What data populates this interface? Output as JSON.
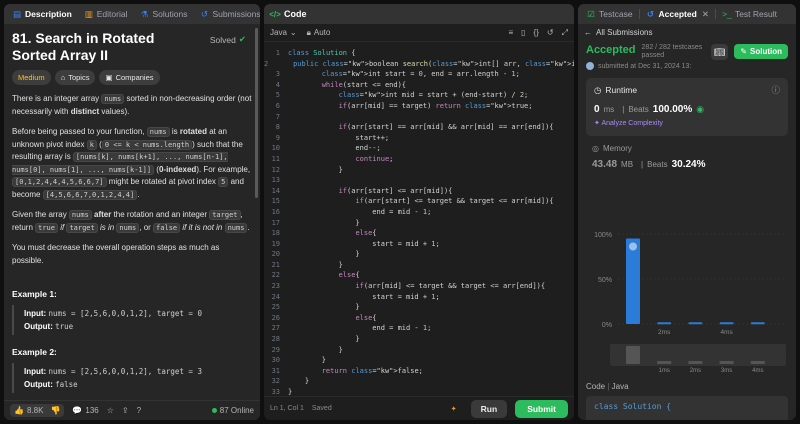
{
  "left": {
    "tabs": [
      {
        "label": "Description",
        "icon": "description-icon"
      },
      {
        "label": "Editorial",
        "icon": "editorial-icon"
      },
      {
        "label": "Solutions",
        "icon": "solutions-icon"
      },
      {
        "label": "Submissions",
        "icon": "submissions-icon"
      }
    ],
    "title": "81. Search in Rotated Sorted Array II",
    "solved": "Solved",
    "chips": {
      "difficulty": "Medium",
      "topics": "Topics",
      "companies": "Companies"
    },
    "p1": [
      "There is an integer array ",
      "nums",
      " sorted in non-decreasing order (not necessarily with ",
      "distinct",
      " values)."
    ],
    "p2": [
      "Before being passed to your function, ",
      "nums",
      " is ",
      "rotated",
      " at an unknown pivot index ",
      "k",
      " (",
      "0 <= k < nums.length",
      ") such that the resulting array is ",
      "[nums[k], nums[k+1], ..., nums[n-1], nums[0], nums[1], ..., nums[k-1]]",
      " (",
      "0-indexed",
      "). For example, ",
      "[0,1,2,4,4,4,5,6,6,7]",
      " might be rotated at pivot index ",
      "5",
      " and become ",
      "[4,5,6,6,7,0,1,2,4,4]",
      "."
    ],
    "p3": [
      "Given the array ",
      "nums",
      " ",
      "after",
      " the rotation and an integer ",
      "target",
      ", return ",
      "true",
      " if ",
      "target",
      " is in ",
      "nums",
      ", or ",
      "false",
      " if it is not in ",
      "nums",
      "."
    ],
    "p4": "You must decrease the overall operation steps as much as possible.",
    "examples": [
      {
        "heading": "Example 1:",
        "input_label": "Input:",
        "input": "nums = [2,5,6,0,0,1,2], target = 0",
        "output_label": "Output:",
        "output": "true"
      },
      {
        "heading": "Example 2:",
        "input_label": "Input:",
        "input": "nums = [2,5,6,0,0,1,2], target = 3",
        "output_label": "Output:",
        "output": "false"
      }
    ],
    "footer": {
      "likes": "8.8K",
      "comments": "136",
      "online": "87 Online"
    }
  },
  "mid": {
    "header": "Code",
    "language": "Java",
    "auto": "Auto",
    "code_lines": [
      "class Solution {",
      "    public boolean search(int[] arr, int target) {",
      "        int start = 0, end = arr.length - 1;",
      "        while(start <= end){",
      "            int mid = start + (end-start) / 2;",
      "            if(arr[mid] == target) return true;",
      "",
      "            if(arr[start] == arr[mid] && arr[mid] == arr[end]){",
      "                start++;",
      "                end--;",
      "                continue;",
      "            }",
      "",
      "            if(arr[start] <= arr[mid]){",
      "                if(arr[start] <= target && target <= arr[mid]){",
      "                    end = mid - 1;",
      "                }",
      "                else{",
      "                    start = mid + 1;",
      "                }",
      "            }",
      "            else{",
      "                if(arr[mid] <= target && target <= arr[end]){",
      "                    start = mid + 1;",
      "                }",
      "                else{",
      "                    end = mid - 1;",
      "                }",
      "            }",
      "        }",
      "        return false;",
      "    }",
      "}"
    ],
    "status": {
      "position": "Ln 1, Col 1",
      "saved": "Saved"
    },
    "run": "Run",
    "submit": "Submit"
  },
  "right": {
    "tabs": [
      {
        "label": "Testcase",
        "icon": "testcase-icon"
      },
      {
        "label": "Accepted",
        "icon": "accepted-icon"
      },
      {
        "label": "Test Result",
        "icon": "terminal-icon"
      }
    ],
    "all_submissions": "All Submissions",
    "accepted": "Accepted",
    "testcases": "282 / 282 testcases passed",
    "submitted": "submitted at Dec 31, 2024 13:",
    "solution_btn": "Solution",
    "runtime": {
      "label": "Runtime",
      "value": "0",
      "unit": "ms",
      "beats_label": "Beats",
      "beats": "100.00%",
      "analyze": "Analyze Complexity"
    },
    "memory": {
      "label": "Memory",
      "value": "43.48",
      "unit": "MB",
      "beats_label": "Beats",
      "beats": "30.24%"
    },
    "chart_data": {
      "type": "bar",
      "title": "",
      "y_ticks": [
        "100%",
        "50%",
        "0%"
      ],
      "ylim": [
        0,
        100
      ],
      "bars": [
        95,
        2,
        2,
        2,
        2
      ],
      "x_ticks_top": [
        "2ms",
        "4ms"
      ],
      "x_ticks_bottom": [
        "1ms",
        "2ms",
        "3ms",
        "4ms"
      ],
      "highlight_index": 0,
      "colors": {
        "bar": "#2b7bd9",
        "highlight": "#2b7bd9"
      }
    },
    "code_section": {
      "label": "Code",
      "lang": "Java",
      "snippet": "class Solution {"
    }
  }
}
